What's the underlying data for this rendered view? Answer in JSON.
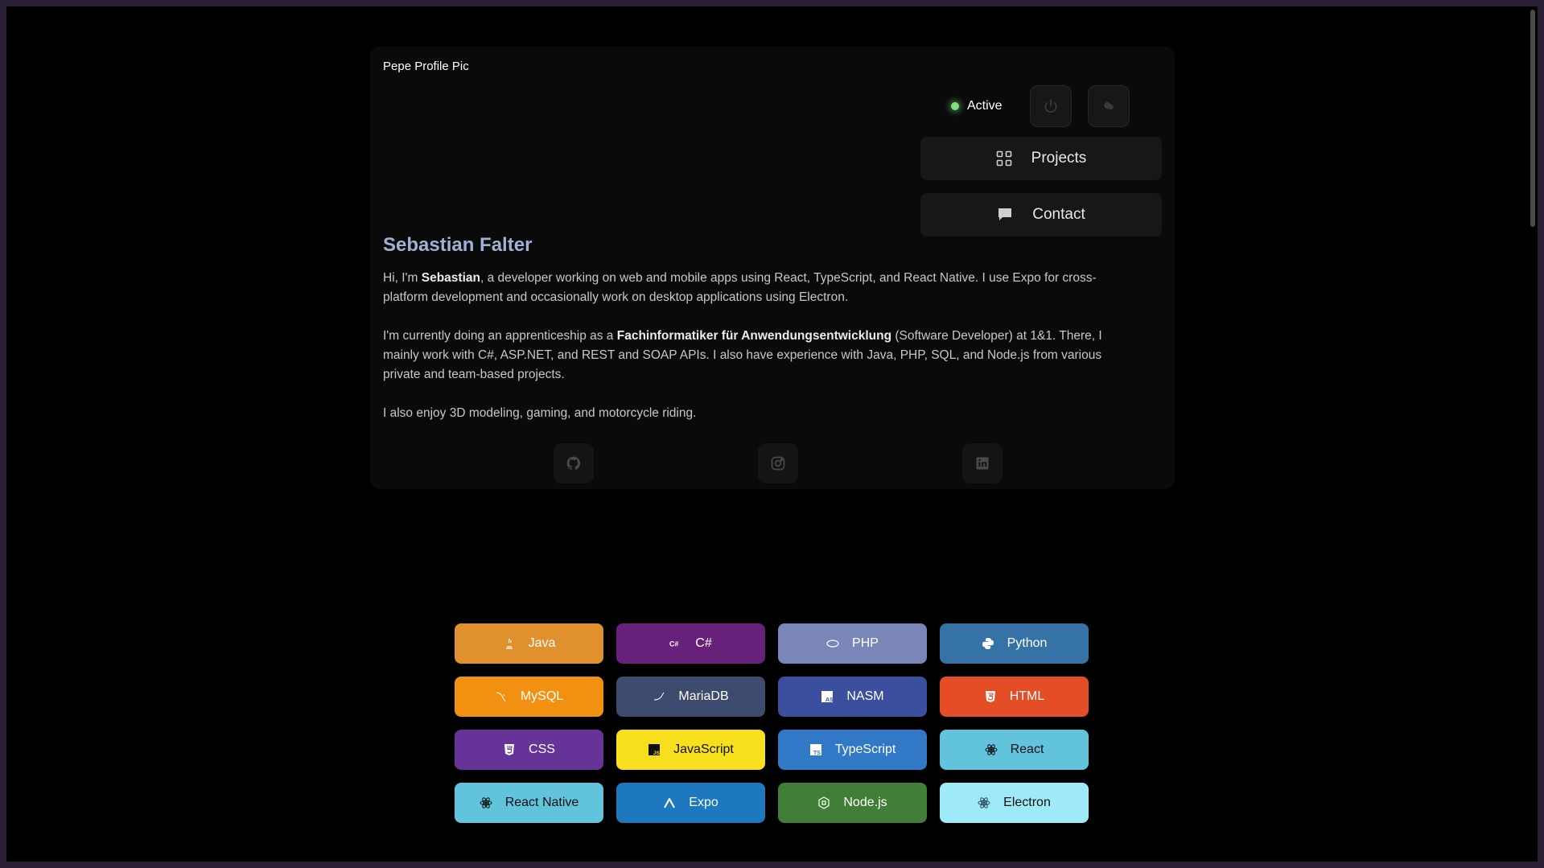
{
  "profile": {
    "pic_alt": "Pepe Profile Pic",
    "name": "Sebastian Falter",
    "status": "Active"
  },
  "nav": {
    "projects": "Projects",
    "contact": "Contact"
  },
  "bio": {
    "p1_a": "Hi, I'm ",
    "p1_b": "Sebastian",
    "p1_c": ", a developer working on web and mobile apps using React, TypeScript, and React Native. I use Expo for cross-platform development and occasionally work on desktop applications using Electron.",
    "p2_a": "I'm currently doing an apprenticeship as a ",
    "p2_b": "Fachinformatiker für Anwendungsentwicklung",
    "p2_c": " (Software Developer) at 1&1. There, I mainly work with C#, ASP.NET, and REST and SOAP APIs. I also have experience with Java, PHP, SQL, and Node.js from various private and team-based projects.",
    "p3": "I also enjoy 3D modeling, gaming, and motorcycle riding."
  },
  "socials": {
    "github": "github-icon",
    "instagram": "instagram-icon",
    "linkedin": "linkedin-icon"
  },
  "skills": [
    {
      "label": "Java",
      "color": "#e0902d",
      "icon": "java-icon"
    },
    {
      "label": "C#",
      "color": "#68217a",
      "icon": "csharp-icon"
    },
    {
      "label": "PHP",
      "color": "#7a86b8",
      "icon": "php-icon"
    },
    {
      "label": "Python",
      "color": "#3572a5",
      "icon": "python-icon"
    },
    {
      "label": "MySQL",
      "color": "#f29111",
      "icon": "mysql-icon"
    },
    {
      "label": "MariaDB",
      "color": "#3f4b6e",
      "icon": "mariadb-icon"
    },
    {
      "label": "NASM",
      "color": "#3b4f9e",
      "icon": "nasm-icon"
    },
    {
      "label": "HTML",
      "color": "#e44d26",
      "icon": "html-icon"
    },
    {
      "label": "CSS",
      "color": "#663399",
      "icon": "css-icon"
    },
    {
      "label": "JavaScript",
      "color": "#f7df1e",
      "icon": "javascript-icon"
    },
    {
      "label": "TypeScript",
      "color": "#3178c6",
      "icon": "typescript-icon"
    },
    {
      "label": "React",
      "color": "#61c4dc",
      "icon": "react-icon"
    },
    {
      "label": "React Native",
      "color": "#61c4dc",
      "icon": "react-icon"
    },
    {
      "label": "Expo",
      "color": "#1d78bd",
      "icon": "expo-icon"
    },
    {
      "label": "Node.js",
      "color": "#417e38",
      "icon": "nodejs-icon"
    },
    {
      "label": "Electron",
      "color": "#9feaf9",
      "icon": "electron-icon"
    }
  ]
}
